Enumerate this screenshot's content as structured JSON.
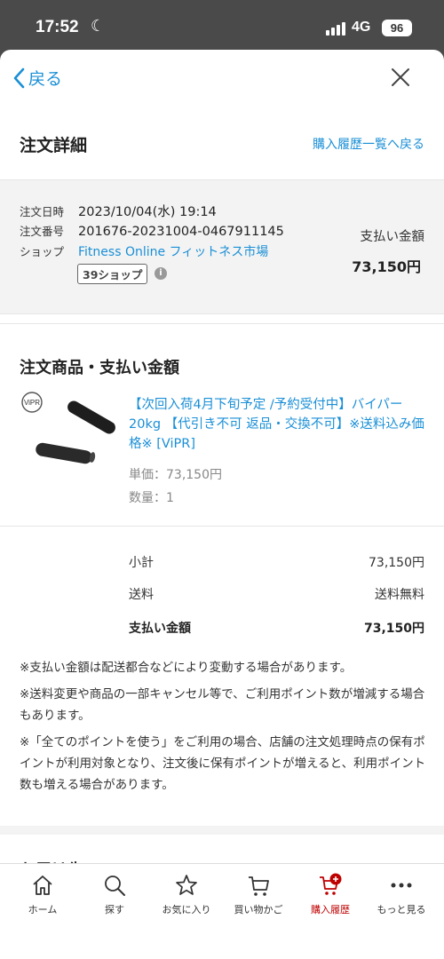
{
  "status": {
    "time": "17:52",
    "network": "4G",
    "battery": "96"
  },
  "nav": {
    "back_label": "戻る"
  },
  "header": {
    "title": "注文詳細",
    "link": "購入履歴一覧へ戻る"
  },
  "order": {
    "date_label": "注文日時",
    "date_value": "2023/10/04(水) 19:14",
    "number_label": "注文番号",
    "number_value": "201676-20231004-0467911145",
    "shop_label": "ショップ",
    "shop_value": "Fitness Online フィットネス市場",
    "shop_badge": "39ショップ",
    "pay_label": "支払い金額",
    "pay_amount": "73,150円"
  },
  "items_section": {
    "title": "注文商品・支払い金額",
    "product": {
      "logo_text": "ViPR",
      "name": "【次回入荷4月下旬予定 /予約受付中】バイパー 20kg 【代引き不可 返品・交換不可】※送料込み価格※ [ViPR]",
      "unit_price": "単価：73,150円",
      "quantity": "数量：1"
    }
  },
  "totals": {
    "subtotal_label": "小計",
    "subtotal_value": "73,150円",
    "shipping_label": "送料",
    "shipping_value": "送料無料",
    "total_label": "支払い金額",
    "total_value": "73,150円"
  },
  "notes": [
    "※支払い金額は配送都合などにより変動する場合があります。",
    "※送料変更や商品の一部キャンセル等で、ご利用ポイント数が増減する場合もあります。",
    "※「全てのポイントを使う」をご利用の場合、店舗の注文処理時点の保有ポイントが利用対象となり、注文後に保有ポイントが増えると、利用ポイント数も増える場合があります。"
  ],
  "next_section": {
    "title": "お届け先"
  },
  "tabbar": {
    "home": "ホーム",
    "search": "探す",
    "favorites": "お気に入り",
    "cart": "買い物かご",
    "history": "購入履歴",
    "more": "もっと見る"
  },
  "colors": {
    "link": "#1a8fd6",
    "active": "#bf0000"
  }
}
